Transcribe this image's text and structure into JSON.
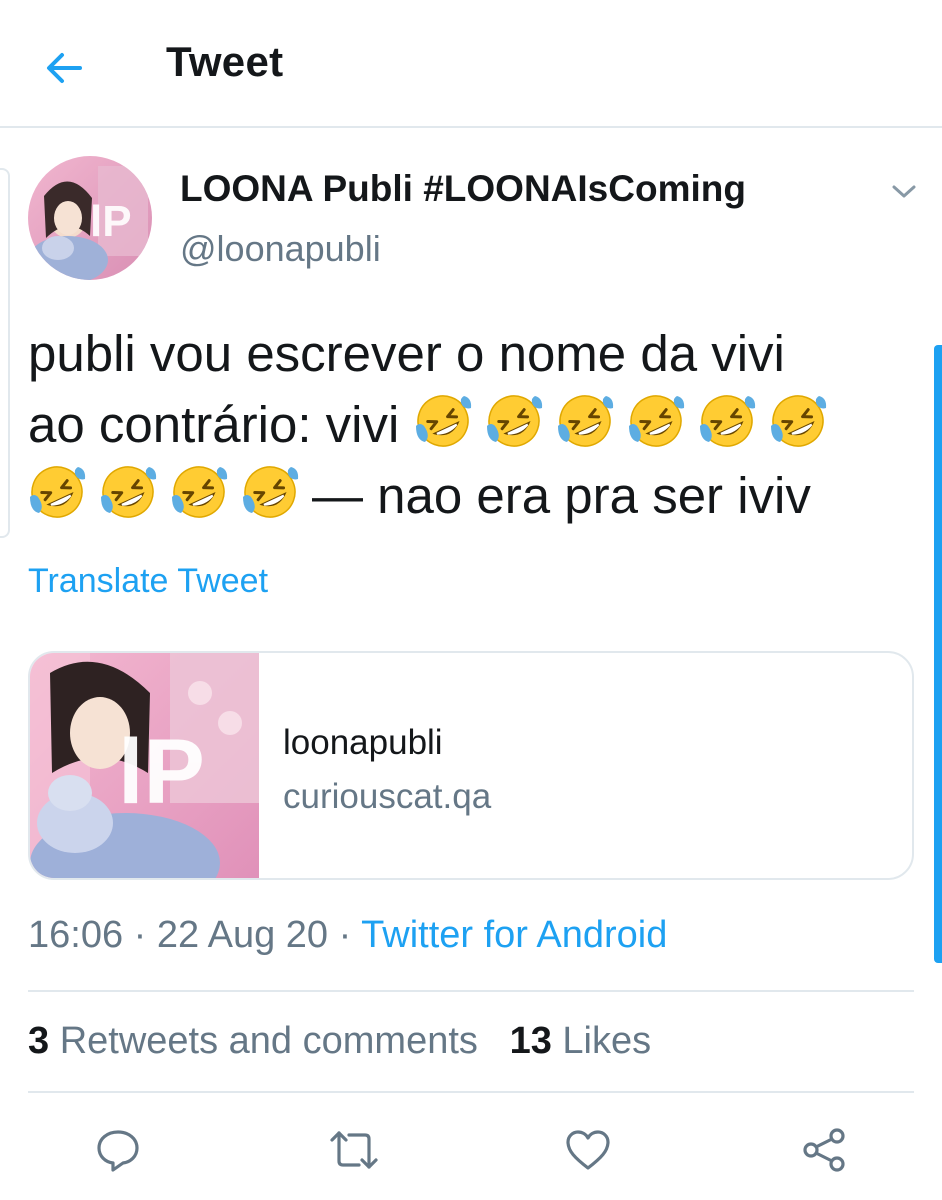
{
  "header": {
    "title": "Tweet",
    "back_icon": "arrow-left-icon"
  },
  "tweet": {
    "author": {
      "display_name": "LOONA Publi #LOONAIsComing",
      "handle": "@loonapubli",
      "avatar_icon": "profile-avatar"
    },
    "text_line_1": "publi vou escrever o nome da vivi",
    "text_line_2_prefix": "ao contrário: vivi",
    "text_line_3_suffix": "— nao era pra ser iviv",
    "emoji_name": "rolling-on-the-floor-laughing",
    "emoji_count_line_2": 6,
    "emoji_count_line_3": 4,
    "translate_label": "Translate Tweet",
    "card": {
      "title": "loonapubli",
      "domain": "curiouscat.qa",
      "thumb_logo_text": "lP"
    },
    "meta": {
      "time": "16:06",
      "separator": "·",
      "date": "22 Aug 20",
      "source": "Twitter for Android"
    },
    "stats": {
      "retweets_count": "3",
      "retweets_label": "Retweets and comments",
      "likes_count": "13",
      "likes_label": "Likes"
    }
  },
  "actions": {
    "reply_icon": "reply-icon",
    "retweet_icon": "retweet-icon",
    "like_icon": "heart-icon",
    "share_icon": "share-icon"
  },
  "colors": {
    "accent": "#1da1f2",
    "secondary_text": "#657786",
    "border": "#e1e8ed",
    "thumb_pink": "#e9a3c3"
  }
}
